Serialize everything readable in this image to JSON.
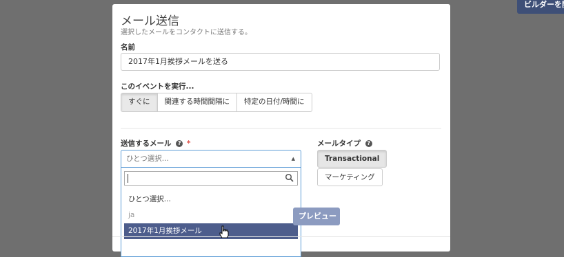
{
  "header": {
    "builder_button": "ビルダーを開く"
  },
  "modal": {
    "title": "メール送信",
    "subtitle": "選択したメールをコンタクトに送信する。",
    "name_label": "名前",
    "name_value": "2017年1月挨拶メールを送る",
    "trigger_label": "このイベントを実行...",
    "trigger_options": [
      "すぐに",
      "関連する時間間隔に",
      "特定の日付/時間に"
    ],
    "send_email_label": "送信するメール",
    "required_mark": "*",
    "select_placeholder": "ひとつ選択...",
    "dropdown": {
      "options": [
        {
          "label": "ひとつ選択...",
          "type": "option"
        },
        {
          "label": "ja",
          "type": "group"
        },
        {
          "label": "2017年1月挨拶メール",
          "type": "highlighted"
        }
      ]
    },
    "email_type_label": "メールタイプ",
    "email_types": [
      "Transactional",
      "マーケティング"
    ],
    "preview_button": "プレビュー"
  }
}
